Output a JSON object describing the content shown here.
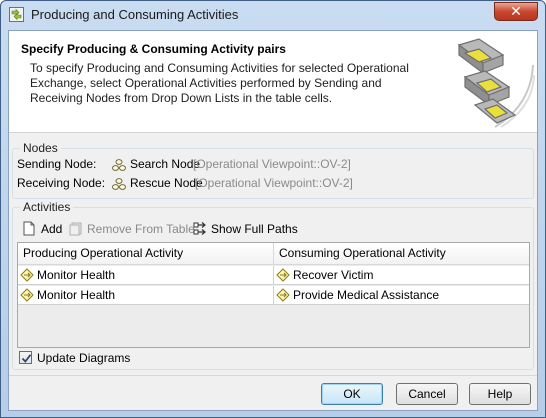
{
  "window": {
    "title": "Producing and Consuming Activities",
    "close_glyph": "✕",
    "app_icon": "producing-consuming-app-icon"
  },
  "header": {
    "title": "Specify Producing & Consuming Activity pairs",
    "description": "To specify Producing and Consuming Activities for selected Operational Exchange, select Operational Activities performed by Sending and Receiving Nodes from Drop Down Lists in the table cells.",
    "graphic": "exchange-arrows-graphic"
  },
  "nodes": {
    "legend": "Nodes",
    "sending": {
      "label": "Sending Node:",
      "name": "Search Node",
      "path": "[Operational Viewpoint::OV-2]",
      "icon": "node-icon"
    },
    "receiving": {
      "label": "Receiving Node:",
      "name": "Rescue Node",
      "path": "[Operational Viewpoint::OV-2]",
      "icon": "node-icon"
    }
  },
  "activities": {
    "legend": "Activities",
    "toolbar": {
      "add": "Add",
      "remove": "Remove From Table",
      "show_paths": "Show Full Paths"
    },
    "table": {
      "columns": [
        "Producing Operational Activity",
        "Consuming Operational Activity"
      ],
      "rows": [
        [
          "Monitor Health",
          "Recover Victim"
        ],
        [
          "Monitor Health",
          "Provide Medical Assistance"
        ]
      ]
    }
  },
  "options": {
    "update_diagrams": "Update Diagrams",
    "update_diagrams_checked": true
  },
  "buttons": {
    "ok": "OK",
    "cancel": "Cancel",
    "help": "Help"
  },
  "colors": {
    "accent": "#3c7fb1",
    "disabled_text": "#8a8a8a",
    "activity_icon": "#c9a400"
  }
}
